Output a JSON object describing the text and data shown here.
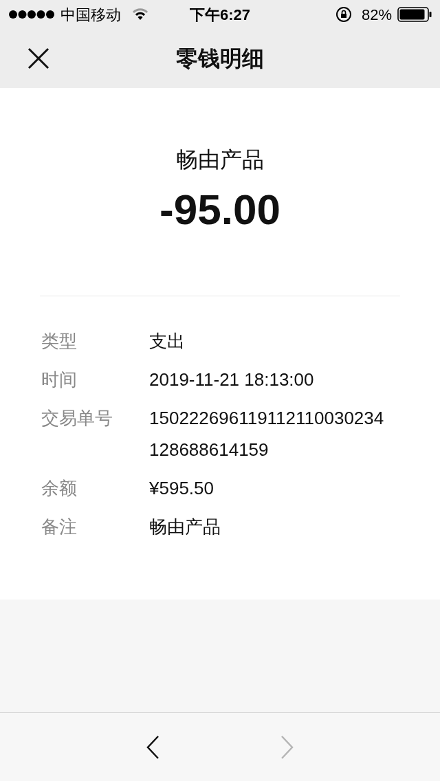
{
  "status_bar": {
    "carrier": "中国移动",
    "time": "下午6:27",
    "battery": "82%"
  },
  "nav": {
    "title": "零钱明细"
  },
  "summary": {
    "merchant": "畅由产品",
    "amount": "-95.00"
  },
  "details": [
    {
      "label": "类型",
      "value": "支出"
    },
    {
      "label": "时间",
      "value": "2019-11-21 18:13:00"
    },
    {
      "label": "交易单号",
      "value": "150222696119112110030234128688614159"
    },
    {
      "label": "余额",
      "value": "¥595.50"
    },
    {
      "label": "备注",
      "value": "畅由产品"
    }
  ],
  "toolbar": {
    "back": {
      "disabled": false
    },
    "forward": {
      "disabled": true
    }
  }
}
